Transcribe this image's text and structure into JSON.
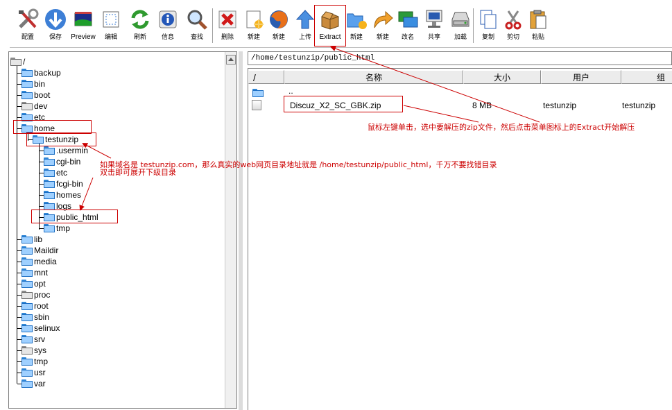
{
  "toolbar": {
    "buttons": [
      {
        "label": "配置",
        "icon": "tools-icon"
      },
      {
        "label": "保存",
        "icon": "save-arrow-icon"
      },
      {
        "label": "Preview",
        "icon": "preview-icon"
      },
      {
        "label": "编辑",
        "icon": "edit-icon"
      },
      {
        "label": "刷新",
        "icon": "refresh-icon"
      },
      {
        "label": "信息",
        "icon": "info-icon"
      },
      {
        "label": "查找",
        "icon": "search-icon"
      },
      {
        "label": "删除",
        "icon": "delete-icon"
      },
      {
        "label": "新建",
        "icon": "new-file-icon"
      },
      {
        "label": "新建",
        "icon": "firefox-icon"
      },
      {
        "label": "上传",
        "icon": "upload-icon"
      },
      {
        "label": "Extract",
        "icon": "extract-box-icon"
      },
      {
        "label": "新建",
        "icon": "new-folder-icon"
      },
      {
        "label": "新建",
        "icon": "new-link-icon"
      },
      {
        "label": "改名",
        "icon": "rename-icon"
      },
      {
        "label": "共享",
        "icon": "share-icon"
      },
      {
        "label": "加载",
        "icon": "mount-icon"
      },
      {
        "label": "复制",
        "icon": "copy-icon"
      },
      {
        "label": "剪切",
        "icon": "cut-icon"
      },
      {
        "label": "粘贴",
        "icon": "paste-icon"
      }
    ]
  },
  "tree": {
    "root": "/",
    "items": [
      {
        "label": "backup"
      },
      {
        "label": "bin"
      },
      {
        "label": "boot"
      },
      {
        "label": "dev"
      },
      {
        "label": "etc"
      },
      {
        "label": "home"
      },
      {
        "label": "testunzip"
      },
      {
        "label": ".usermin"
      },
      {
        "label": "cgi-bin"
      },
      {
        "label": "etc"
      },
      {
        "label": "fcgi-bin"
      },
      {
        "label": "homes"
      },
      {
        "label": "logs"
      },
      {
        "label": "public_html"
      },
      {
        "label": "tmp"
      },
      {
        "label": "lib"
      },
      {
        "label": "Maildir"
      },
      {
        "label": "media"
      },
      {
        "label": "mnt"
      },
      {
        "label": "opt"
      },
      {
        "label": "proc"
      },
      {
        "label": "root"
      },
      {
        "label": "sbin"
      },
      {
        "label": "selinux"
      },
      {
        "label": "srv"
      },
      {
        "label": "sys"
      },
      {
        "label": "tmp"
      },
      {
        "label": "usr"
      },
      {
        "label": "var"
      }
    ]
  },
  "path": "/home/testunzip/public_html",
  "file_table": {
    "headers": {
      "sort": "/",
      "name": "名称",
      "size": "大小",
      "user": "用户",
      "group": "组"
    },
    "rows": [
      {
        "name": "..",
        "size": "",
        "user": "",
        "group": ""
      },
      {
        "name": "Discuz_X2_SC_GBK.zip",
        "size": "8 MB",
        "user": "testunzip",
        "group": "testunzip"
      }
    ]
  },
  "annotations": {
    "extract_note": "鼠标左键单击，选中要解压的zip文件，然后点击菜单图标上的Extract开始解压",
    "domain_note": "如果域名是 testunzip.com，那么真实的web网页目录地址就是 /home/testunzip/public_html，千万不要找错目录",
    "expand_note": "双击即可展开下级目录"
  },
  "colors": {
    "annotation": "#cc0000",
    "folder": "#1d6fc4"
  }
}
